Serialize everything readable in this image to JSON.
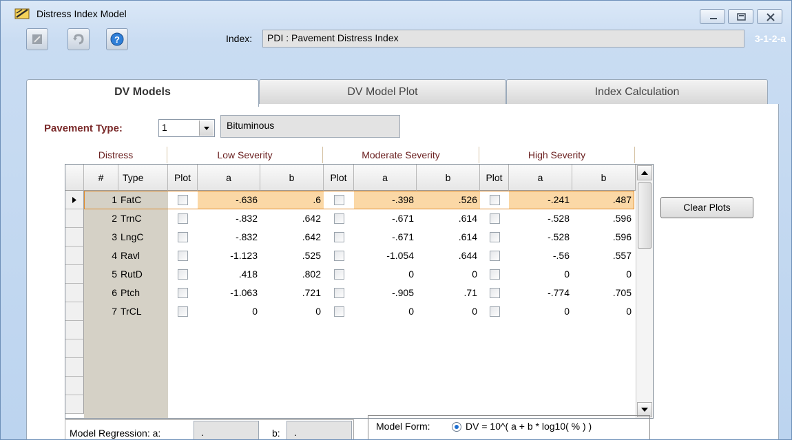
{
  "window": {
    "title": "Distress Index Model"
  },
  "toolbar": {
    "index_label": "Index:",
    "index_value": "PDI  :  Pavement Distress Index",
    "form_code": "3-1-2-a"
  },
  "tabs": [
    {
      "label": "DV Models",
      "active": true
    },
    {
      "label": "DV Model Plot",
      "active": false
    },
    {
      "label": "Index Calculation",
      "active": false
    }
  ],
  "pavement": {
    "label": "Pavement Type:",
    "code": "1",
    "name": "Bituminous"
  },
  "grid": {
    "groups": [
      "Distress",
      "Low Severity",
      "Moderate Severity",
      "High Severity"
    ],
    "columns": [
      "#",
      "Type",
      "Plot",
      "a",
      "b",
      "Plot",
      "a",
      "b",
      "Plot",
      "a",
      "b"
    ],
    "rows": [
      {
        "num": "1",
        "type": "FatC",
        "low_a": "-.636",
        "low_b": ".6",
        "mod_a": "-.398",
        "mod_b": ".526",
        "high_a": "-.241",
        "high_b": ".487"
      },
      {
        "num": "2",
        "type": "TrnC",
        "low_a": "-.832",
        "low_b": ".642",
        "mod_a": "-.671",
        "mod_b": ".614",
        "high_a": "-.528",
        "high_b": ".596"
      },
      {
        "num": "3",
        "type": "LngC",
        "low_a": "-.832",
        "low_b": ".642",
        "mod_a": "-.671",
        "mod_b": ".614",
        "high_a": "-.528",
        "high_b": ".596"
      },
      {
        "num": "4",
        "type": "Ravl",
        "low_a": "-1.123",
        "low_b": ".525",
        "mod_a": "-1.054",
        "mod_b": ".644",
        "high_a": "-.56",
        "high_b": ".557"
      },
      {
        "num": "5",
        "type": "RutD",
        "low_a": ".418",
        "low_b": ".802",
        "mod_a": "0",
        "mod_b": "0",
        "high_a": "0",
        "high_b": "0"
      },
      {
        "num": "6",
        "type": "Ptch",
        "low_a": "-1.063",
        "low_b": ".721",
        "mod_a": "-.905",
        "mod_b": ".71",
        "high_a": "-.774",
        "high_b": ".705"
      },
      {
        "num": "7",
        "type": "TrCL",
        "low_a": "0",
        "low_b": "0",
        "mod_a": "0",
        "mod_b": "0",
        "high_a": "0",
        "high_b": "0"
      }
    ]
  },
  "buttons": {
    "clear_plots": "Clear Plots"
  },
  "regression": {
    "label": "Model Regression:  a:",
    "a": ".",
    "b_label": "b:",
    "b": "."
  },
  "model_form": {
    "label": "Model Form:",
    "formula": "DV = 10^( a + b * log10( % ) )"
  },
  "colors": {
    "highlight_row": "#fbd8a6",
    "group_header_text": "#6b2020",
    "pavement_label": "#7a2a2a"
  }
}
